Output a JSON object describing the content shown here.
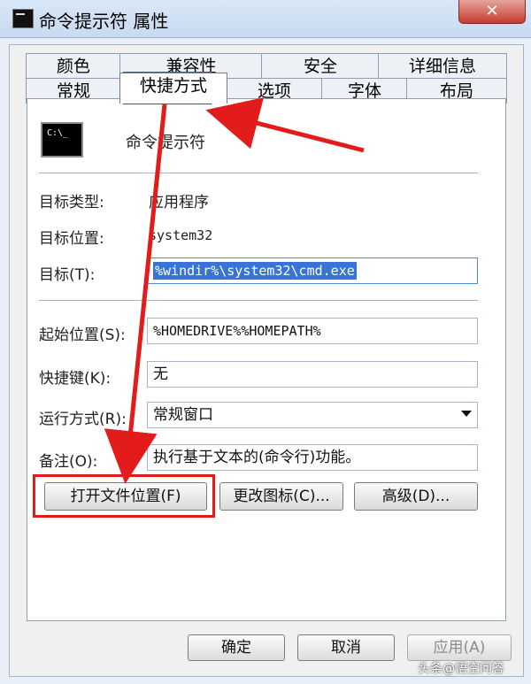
{
  "window": {
    "title": "命令提示符 属性",
    "close_label": "✕"
  },
  "tabs": {
    "top": [
      "颜色",
      "兼容性",
      "安全",
      "详细信息"
    ],
    "bottom": [
      "常规",
      "快捷方式",
      "选项",
      "字体",
      "布局"
    ],
    "active": "快捷方式"
  },
  "shortcut": {
    "name": "命令提示符",
    "target_type_label": "目标类型:",
    "target_type_value": "应用程序",
    "target_location_label": "目标位置:",
    "target_location_value": "system32",
    "target_label": "目标(T):",
    "target_value": "%windir%\\system32\\cmd.exe",
    "start_in_label": "起始位置(S):",
    "start_in_value": "%HOMEDRIVE%%HOMEPATH%",
    "hotkey_label": "快捷键(K):",
    "hotkey_value": "无",
    "run_label": "运行方式(R):",
    "run_value": "常规窗口",
    "comment_label": "备注(O):",
    "comment_value": "执行基于文本的(命令行)功能。"
  },
  "actions": {
    "open_location": "打开文件位置(F)",
    "change_icon": "更改图标(C)...",
    "advanced": "高级(D)..."
  },
  "footer": {
    "ok": "确定",
    "cancel": "取消",
    "apply": "应用(A)"
  },
  "overlay": {
    "watermark": "头条@悟空问答"
  },
  "colors": {
    "annotation_red": "#e21b1b",
    "selection_blue": "#3874d8"
  }
}
